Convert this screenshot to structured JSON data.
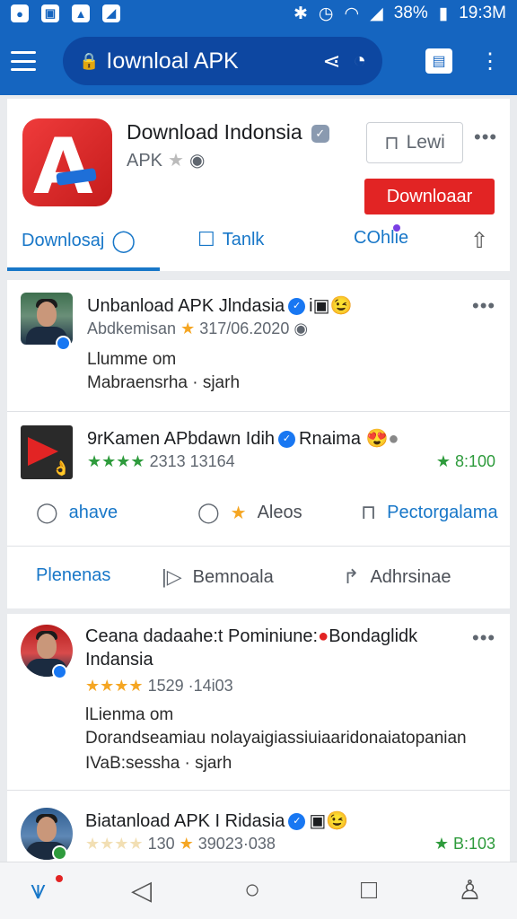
{
  "status_bar": {
    "battery": "38%",
    "time": "19:3M"
  },
  "app_bar": {
    "url": "Iownloal  APK"
  },
  "app_header": {
    "title": "Download Indonsia",
    "subtitle": "APK",
    "lewi_button": "Lewi",
    "download_button": "Downloaar",
    "tabs": {
      "downloads": "Downlosaj",
      "tanlik": "Tanlk",
      "online": "COhlie"
    }
  },
  "posts": [
    {
      "name": "Unbanload APK Jlndasia",
      "meta_prefix": "Abdkemisan",
      "meta_date": "317/06.2020",
      "line1": "Llumme om",
      "line2": "Mabraensrha · sjarh"
    },
    {
      "name": "9rKamen APbdawn Idih",
      "name_suffix": "Rnaima",
      "stars": "★★★★",
      "meta": "2313 13164",
      "rating": "★ 8:100"
    }
  ],
  "post_actions": {
    "share": "ahave",
    "aleos": "Aleos",
    "pector": "Pectorgalama"
  },
  "bottom_actions": {
    "plenenas": "Plenenas",
    "bemnoala": "Bemnoala",
    "adhrsinae": "Adhrsinae"
  },
  "post3": {
    "name_line1": "Ceana dadaahe:t Pominiune:",
    "name_tag": "Bondaglidk",
    "name_line2": "Indansia",
    "stars": "★★★★",
    "meta": "1529 ·14i03",
    "line1": "lLienma om",
    "line2": "Dorandseamiau nolayaigiassiuiaaridonaiatopanian",
    "line3": "IVaB:sessha · sjarh"
  },
  "post4": {
    "name": "Biatanload APK I Ridasia",
    "faded_stars": "★★★★",
    "meta_a": "130",
    "meta_b": "39023·038",
    "rating": "★ B:103"
  },
  "colors": {
    "primary": "#1565c0",
    "accent_red": "#e22424",
    "link_blue": "#1877c8",
    "green": "#2e9b3c"
  }
}
